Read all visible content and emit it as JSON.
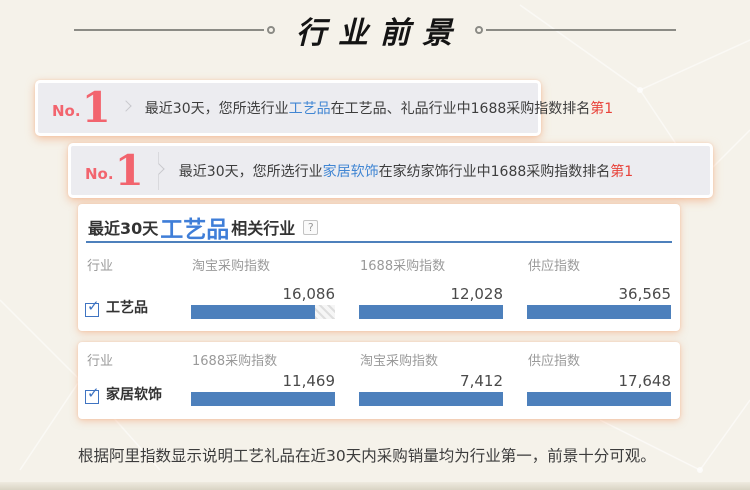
{
  "page": {
    "title": "行业前景",
    "footer_note": "根据阿里指数显示说明工艺礼品在近30天内采购销量均为行业第一，前景十分可观。"
  },
  "colors": {
    "bar_blue": "#4d80bc",
    "rank_red": "#f2646e",
    "highlight_red": "#e8423a",
    "link_blue": "#4186d3",
    "header_blue": "#3f7ed8"
  },
  "icons": {
    "help_icon": "?",
    "check_icon": "✓"
  },
  "banners": [
    {
      "rank_prefix": "No.",
      "rank_number": "1",
      "text_before": "最近30天，您所选行业",
      "industry_link": "工艺品",
      "text_after": "在工艺品、礼品行业中1688采购指数排名",
      "rank_label": "第1"
    },
    {
      "rank_prefix": "No.",
      "rank_number": "1",
      "text_before": "最近30天，您所选行业",
      "industry_link": "家居软饰",
      "text_after": "在家纺家饰行业中1688采购指数排名",
      "rank_label": "第1"
    }
  ],
  "report": {
    "header_prefix": "最近30天",
    "header_industry": "工艺品",
    "header_suffix": "相关行业"
  },
  "tables": [
    {
      "columns": [
        "行业",
        "淘宝采购指数",
        "1688采购指数",
        "供应指数"
      ],
      "row": {
        "label": "工艺品",
        "checked": true,
        "values": [
          "16,086",
          "12,028",
          "36,565"
        ],
        "fills": [
          0.86,
          1,
          1
        ]
      }
    },
    {
      "columns": [
        "行业",
        "1688采购指数",
        "淘宝采购指数",
        "供应指数"
      ],
      "row": {
        "label": "家居软饰",
        "checked": true,
        "values": [
          "11,469",
          "7,412",
          "17,648"
        ],
        "fills": [
          1,
          1,
          1
        ]
      }
    }
  ],
  "chart_data": [
    {
      "type": "bar",
      "title": "最近30天工艺品相关行业",
      "categories": [
        "淘宝采购指数",
        "1688采购指数",
        "供应指数"
      ],
      "series": [
        {
          "name": "工艺品",
          "values": [
            16086,
            12028,
            36565
          ]
        }
      ],
      "legend_position": "none",
      "grid": false
    },
    {
      "type": "bar",
      "title": "家居软饰相关行业",
      "categories": [
        "1688采购指数",
        "淘宝采购指数",
        "供应指数"
      ],
      "series": [
        {
          "name": "家居软饰",
          "values": [
            11469,
            7412,
            17648
          ]
        }
      ],
      "legend_position": "none",
      "grid": false
    }
  ]
}
